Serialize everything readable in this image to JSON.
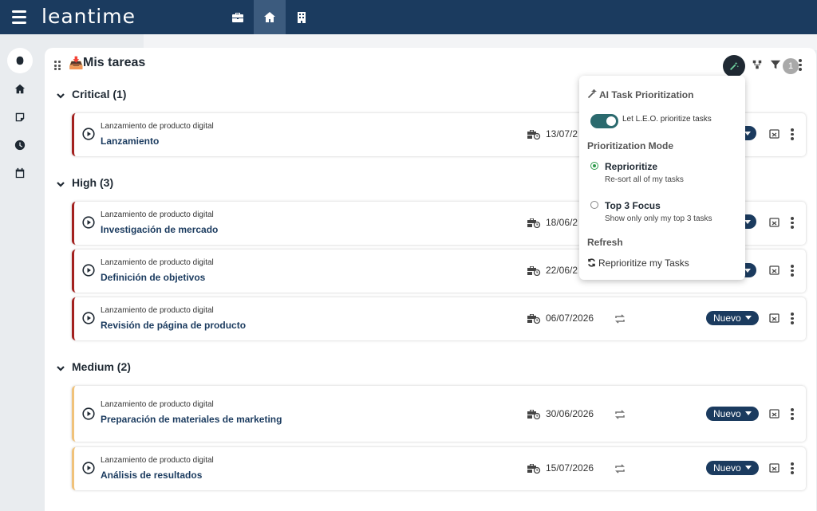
{
  "app": {
    "logo": "leantime"
  },
  "page": {
    "title": "Mis tareas",
    "filter_count": "1"
  },
  "groups": [
    {
      "title": "Critical (1)"
    },
    {
      "title": "High (3)"
    },
    {
      "title": "Medium (2)"
    }
  ],
  "tasks": [
    {
      "project": "Lanzamiento de producto digital",
      "name": "Lanzamiento",
      "due": "13/07/2",
      "status": ""
    },
    {
      "project": "Lanzamiento de producto digital",
      "name": "Investigación de mercado",
      "due": "18/06/2",
      "status": ""
    },
    {
      "project": "Lanzamiento de producto digital",
      "name": "Definición de objetivos",
      "due": "22/06/2",
      "status": ""
    },
    {
      "project": "Lanzamiento de producto digital",
      "name": "Revisión de página de producto",
      "due": "06/07/2026",
      "status": "Nuevo"
    },
    {
      "project": "Lanzamiento de producto digital",
      "name": "Preparación de materiales de marketing",
      "due": "30/06/2026",
      "status": "Nuevo"
    },
    {
      "project": "Lanzamiento de producto digital",
      "name": "Análisis de resultados",
      "due": "15/07/2026",
      "status": "Nuevo"
    }
  ],
  "popover": {
    "title": "AI Task Prioritization",
    "toggle_label": "Let L.E.O. prioritize tasks",
    "mode_heading": "Prioritization Mode",
    "options": [
      {
        "label": "Reprioritize",
        "desc": "Re-sort all of my tasks",
        "checked": true
      },
      {
        "label": "Top 3 Focus",
        "desc": "Show only only my top 3 tasks",
        "checked": false
      }
    ],
    "refresh_heading": "Refresh",
    "refresh_link": "Reprioritize my Tasks"
  },
  "colors": {
    "topbar": "#1b3b5f",
    "critical": "#a3211f",
    "medium": "#f0c27a",
    "status": "#1b3b5f",
    "toggle": "#2b6a6e"
  },
  "icons": {
    "top_nav": [
      "briefcase-icon",
      "home-project-icon",
      "building-icon"
    ],
    "rail": [
      "brain-icon",
      "home-icon",
      "note-icon",
      "clock-icon",
      "calendar-icon"
    ]
  }
}
